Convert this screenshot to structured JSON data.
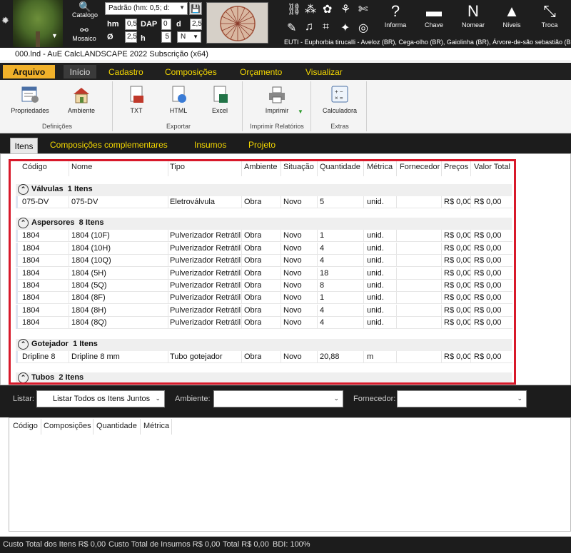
{
  "toolbar": {
    "catalogo": "Catalogo",
    "mosaico": "Mosaico",
    "preset": "Padrão (hm: 0,5; d:",
    "hm_label": "hm",
    "hm_value": "0,5",
    "dap_label": "DAP",
    "dap_value": "0",
    "d_label": "d",
    "d_value": "2,5",
    "o_label": "Ø",
    "o_value": "2,5",
    "h_label": "h",
    "h_value": "5",
    "n_value": "N",
    "informa": "Informa",
    "chave": "Chave",
    "nomear": "Nomear",
    "niveis": "Níveis",
    "troca": "Troca",
    "species": "EUTI - Euphorbia tirucalli - Aveloz (BR), Cega-olho (BR), Gaiolinha (BR), Árvore-de-são sebastião (BR)"
  },
  "title": "000.lnd - AuE CalcLANDSCAPE 2022 Subscrição (x64)",
  "ribbon_tabs": [
    "Arquivo",
    "Início",
    "Cadastro",
    "Composições",
    "Orçamento",
    "Visualizar"
  ],
  "ribbon": {
    "propriedades": "Propriedades",
    "ambiente": "Ambiente",
    "definicoes": "Definições",
    "txt": "TXT",
    "html": "HTML",
    "excel": "Excel",
    "exportar": "Exportar",
    "imprimir": "Imprimir",
    "imprimir_relatorios": "Imprimir Relatórios",
    "calculadora": "Calculadora",
    "extras": "Extras"
  },
  "tabs2": [
    "Itens",
    "Composições complementares",
    "Insumos",
    "Projeto"
  ],
  "grid": {
    "columns": [
      "Código",
      "Nome",
      "Tipo",
      "Ambiente",
      "Situação",
      "Quantidade",
      "Métrica",
      "Fornecedor",
      "Preços",
      "Valor Total"
    ],
    "groups": [
      {
        "title": "Válvulas",
        "count": "1 Itens",
        "rows": [
          [
            "075-DV",
            "075-DV",
            "Eletroválvula",
            "Obra",
            "Novo",
            "5",
            "unid.",
            "",
            "R$ 0,00",
            "R$ 0,00"
          ]
        ]
      },
      {
        "title": "Aspersores",
        "count": "8 Itens",
        "rows": [
          [
            "1804",
            "1804 (10F)",
            "Pulverizador Retrátil",
            "Obra",
            "Novo",
            "1",
            "unid.",
            "",
            "R$ 0,00",
            "R$ 0,00"
          ],
          [
            "1804",
            "1804 (10H)",
            "Pulverizador Retrátil",
            "Obra",
            "Novo",
            "4",
            "unid.",
            "",
            "R$ 0,00",
            "R$ 0,00"
          ],
          [
            "1804",
            "1804 (10Q)",
            "Pulverizador Retrátil",
            "Obra",
            "Novo",
            "4",
            "unid.",
            "",
            "R$ 0,00",
            "R$ 0,00"
          ],
          [
            "1804",
            "1804 (5H)",
            "Pulverizador Retrátil",
            "Obra",
            "Novo",
            "18",
            "unid.",
            "",
            "R$ 0,00",
            "R$ 0,00"
          ],
          [
            "1804",
            "1804 (5Q)",
            "Pulverizador Retrátil",
            "Obra",
            "Novo",
            "8",
            "unid.",
            "",
            "R$ 0,00",
            "R$ 0,00"
          ],
          [
            "1804",
            "1804 (8F)",
            "Pulverizador Retrátil",
            "Obra",
            "Novo",
            "1",
            "unid.",
            "",
            "R$ 0,00",
            "R$ 0,00"
          ],
          [
            "1804",
            "1804 (8H)",
            "Pulverizador Retrátil",
            "Obra",
            "Novo",
            "4",
            "unid.",
            "",
            "R$ 0,00",
            "R$ 0,00"
          ],
          [
            "1804",
            "1804 (8Q)",
            "Pulverizador Retrátil",
            "Obra",
            "Novo",
            "4",
            "unid.",
            "",
            "R$ 0,00",
            "R$ 0,00"
          ]
        ]
      },
      {
        "title": "Gotejador",
        "count": "1 Itens",
        "rows": [
          [
            "Dripline 8",
            "Dripline 8 mm",
            "Tubo gotejador",
            "Obra",
            "Novo",
            "20,88",
            "m",
            "",
            "R$ 0,00",
            "R$ 0,00"
          ]
        ]
      },
      {
        "title": "Tubos",
        "count": "2 Itens",
        "rows": []
      }
    ]
  },
  "filters": {
    "listar_label": "Listar:",
    "listar_value": "Listar Todos os Itens Juntos",
    "ambiente_label": "Ambiente:",
    "ambiente_value": "",
    "fornecedor_label": "Fornecedor:",
    "fornecedor_value": ""
  },
  "lower_grid": {
    "columns": [
      "Código",
      "Composições",
      "Quantidade",
      "Métrica"
    ]
  },
  "status": {
    "custo_itens": "Custo Total dos Itens R$ 0,00",
    "custo_insumos": "Custo Total de Insumos R$ 0,00",
    "total": "Total R$ 0,00",
    "bdi": "BDI: 100%"
  },
  "colors": {
    "accent": "#f5d800",
    "arquivo": "#f1b12a",
    "highlight": "#d8192a"
  }
}
